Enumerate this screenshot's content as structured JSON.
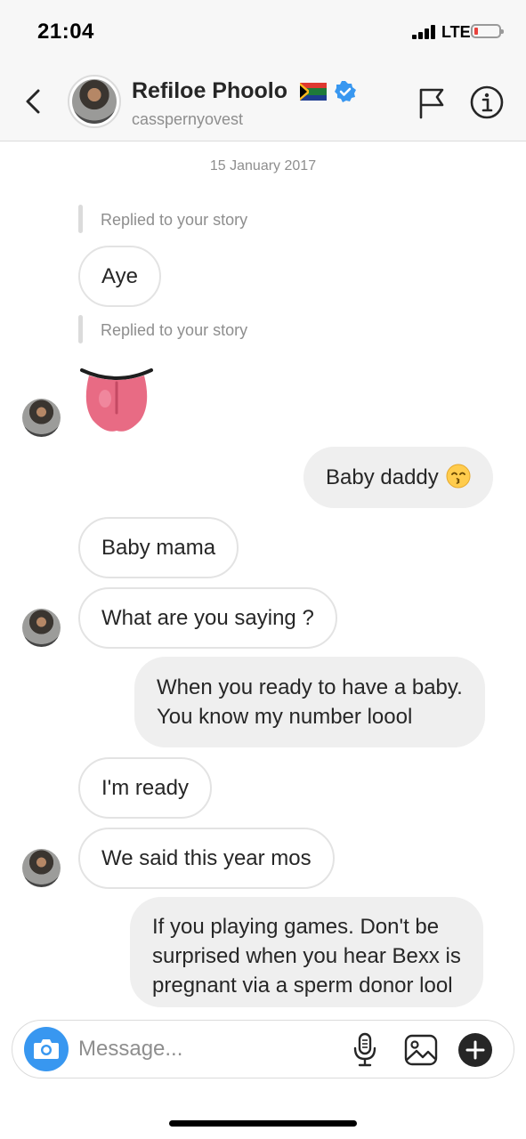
{
  "status_bar": {
    "time": "21:04",
    "network": "LTE",
    "battery_color": "#e8413c"
  },
  "header": {
    "display_name": "Refiloe Phoolo",
    "username": "casspernyovest",
    "flag_emoji": "south-africa-flag",
    "verified": true,
    "verified_color": "#3897f0",
    "icons": [
      "back-chevron-icon",
      "report-flag-icon",
      "info-icon"
    ]
  },
  "thread": {
    "date": "15 January 2017",
    "reply_notes": [
      "Replied to your story",
      "Replied to your story"
    ],
    "messages": [
      {
        "side": "incoming",
        "text": "Aye"
      },
      {
        "side": "incoming",
        "emoji": "stuck-out-tongue"
      },
      {
        "side": "outgoing",
        "text": "Baby daddy",
        "emoji": "kissing-smiling-eyes"
      },
      {
        "side": "incoming",
        "text": "Baby mama"
      },
      {
        "side": "incoming",
        "text": "What are you saying ?"
      },
      {
        "side": "outgoing",
        "lines": [
          "When you ready to have a baby.",
          "You know my number loool"
        ]
      },
      {
        "side": "incoming",
        "text": "I'm ready"
      },
      {
        "side": "incoming",
        "text": "We said this year mos"
      },
      {
        "side": "outgoing",
        "lines": [
          "If you playing games. Don't be",
          "surprised when you hear Bexx is",
          "pregnant via a sperm donor  lool"
        ]
      }
    ]
  },
  "composer": {
    "placeholder": "Message...",
    "accent_color": "#3897f0",
    "icons": [
      "camera-icon",
      "microphone-icon",
      "gallery-icon",
      "plus-icon"
    ]
  }
}
